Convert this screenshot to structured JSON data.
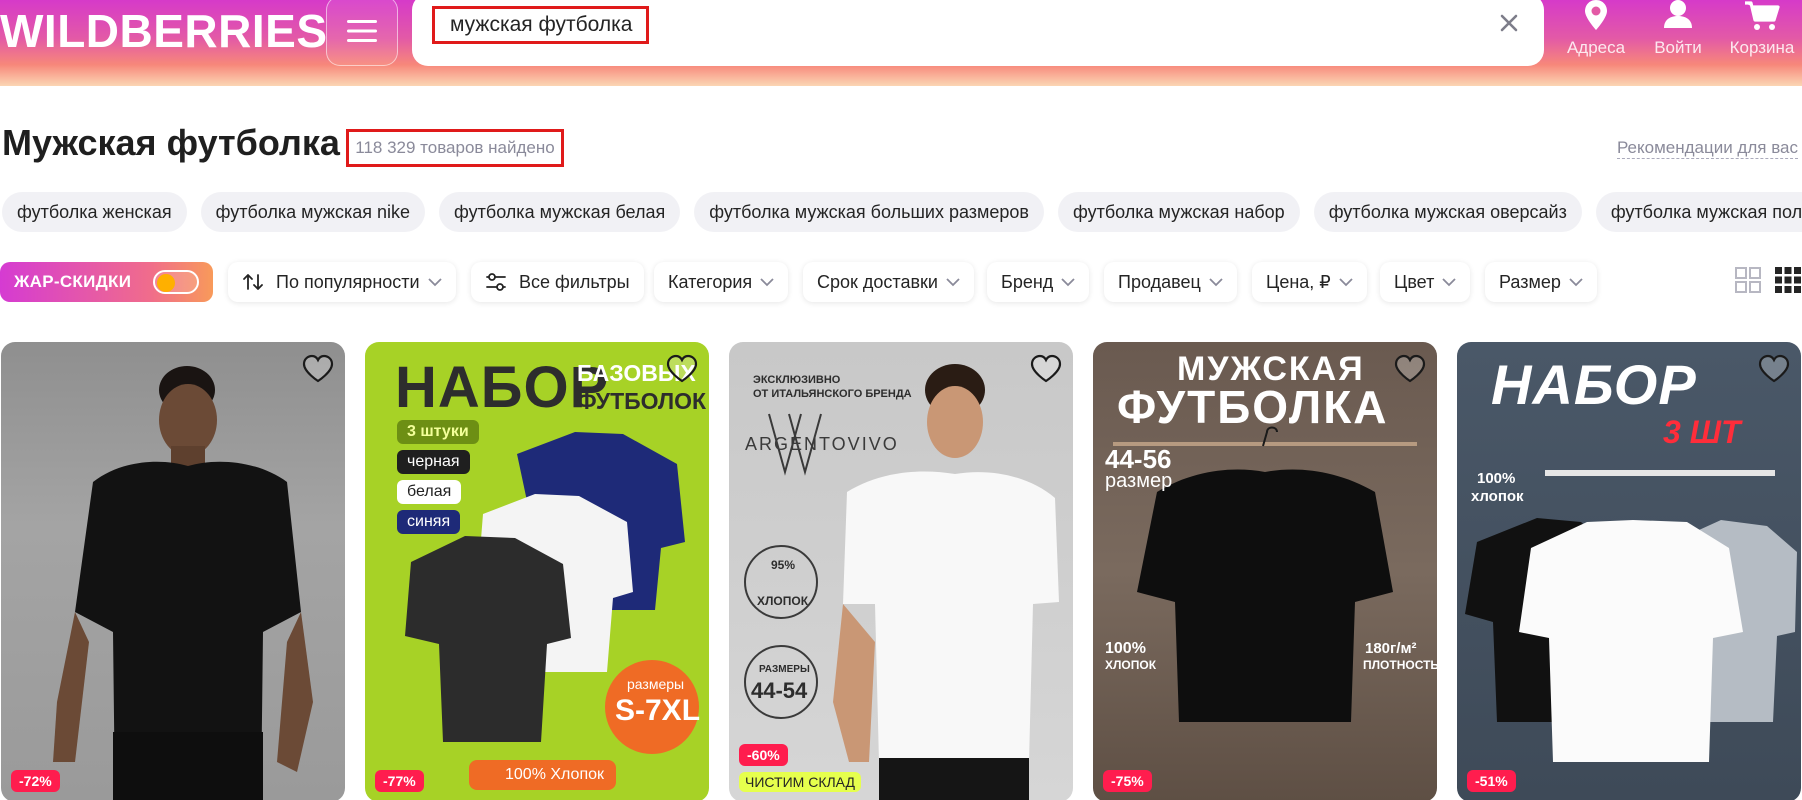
{
  "header": {
    "logo": "WILDBERRIES",
    "search_value": "мужская футболка",
    "nav": [
      {
        "label": "Адреса",
        "icon": "location-pin-icon"
      },
      {
        "label": "Войти",
        "icon": "user-icon"
      },
      {
        "label": "Корзина",
        "icon": "cart-icon"
      }
    ]
  },
  "main": {
    "title": "Мужская футболка",
    "count": "118 329 товаров найдено",
    "recommendations_link": "Рекомендации для вас"
  },
  "chips": [
    "футболка женская",
    "футболка мужская nike",
    "футболка мужская белая",
    "футболка мужская больших размеров",
    "футболка мужская набор",
    "футболка мужская оверсайз",
    "футболка мужская поло"
  ],
  "filters": {
    "hot_label": "ЖАР-СКИДКИ",
    "sort_label": "По популярности",
    "all_filters_label": "Все фильтры",
    "items": [
      "Категория",
      "Срок доставки",
      "Бренд",
      "Продавец",
      "Цена, ₽",
      "Цвет",
      "Размер"
    ]
  },
  "products": [
    {
      "discount": "-72%"
    },
    {
      "discount": "-77%",
      "line1": "НАБОР",
      "line2": "БАЗОВЫХ",
      "line3": "ФУТБОЛОК",
      "tag1": "3 штуки",
      "tag2": "черная",
      "tag3": "белая",
      "tag4": "синяя",
      "size_label": "размеры",
      "size_value": "S-7XL",
      "bottom": "100% Хлопок"
    },
    {
      "discount": "-60%",
      "promo": "ЧИСТИМ СКЛАД",
      "line1": "ЭКСКЛЮЗИВНО",
      "line2": "ОТ ИТАЛЬЯНСКОГО БРЕНДА",
      "brand": "ARGENTOVIVO",
      "cotton_pct": "95%",
      "cotton_word": "ХЛОПОК",
      "sizes_label": "РАЗМЕРЫ",
      "sizes_value": "44-54"
    },
    {
      "discount": "-75%",
      "line1": "МУЖСКАЯ",
      "line2": "ФУТБОЛКА",
      "size_value": "44-56",
      "size_word": "размер",
      "cotton_pct": "100%",
      "cotton_word": "ХЛОПОК",
      "density_value": "180г/м²",
      "density_word": "ПЛОТНОСТЬ"
    },
    {
      "discount": "-51%",
      "line1": "НАБОР",
      "line2": "3 ШТ",
      "cotton_pct": "100%",
      "cotton_word": "хлопок"
    }
  ],
  "colors": {
    "accent_gradient_start": "#d63ac9",
    "accent_gradient_end": "#f7877a",
    "discount_badge": "#ff1d4e",
    "highlight_box": "#e01a1a"
  }
}
